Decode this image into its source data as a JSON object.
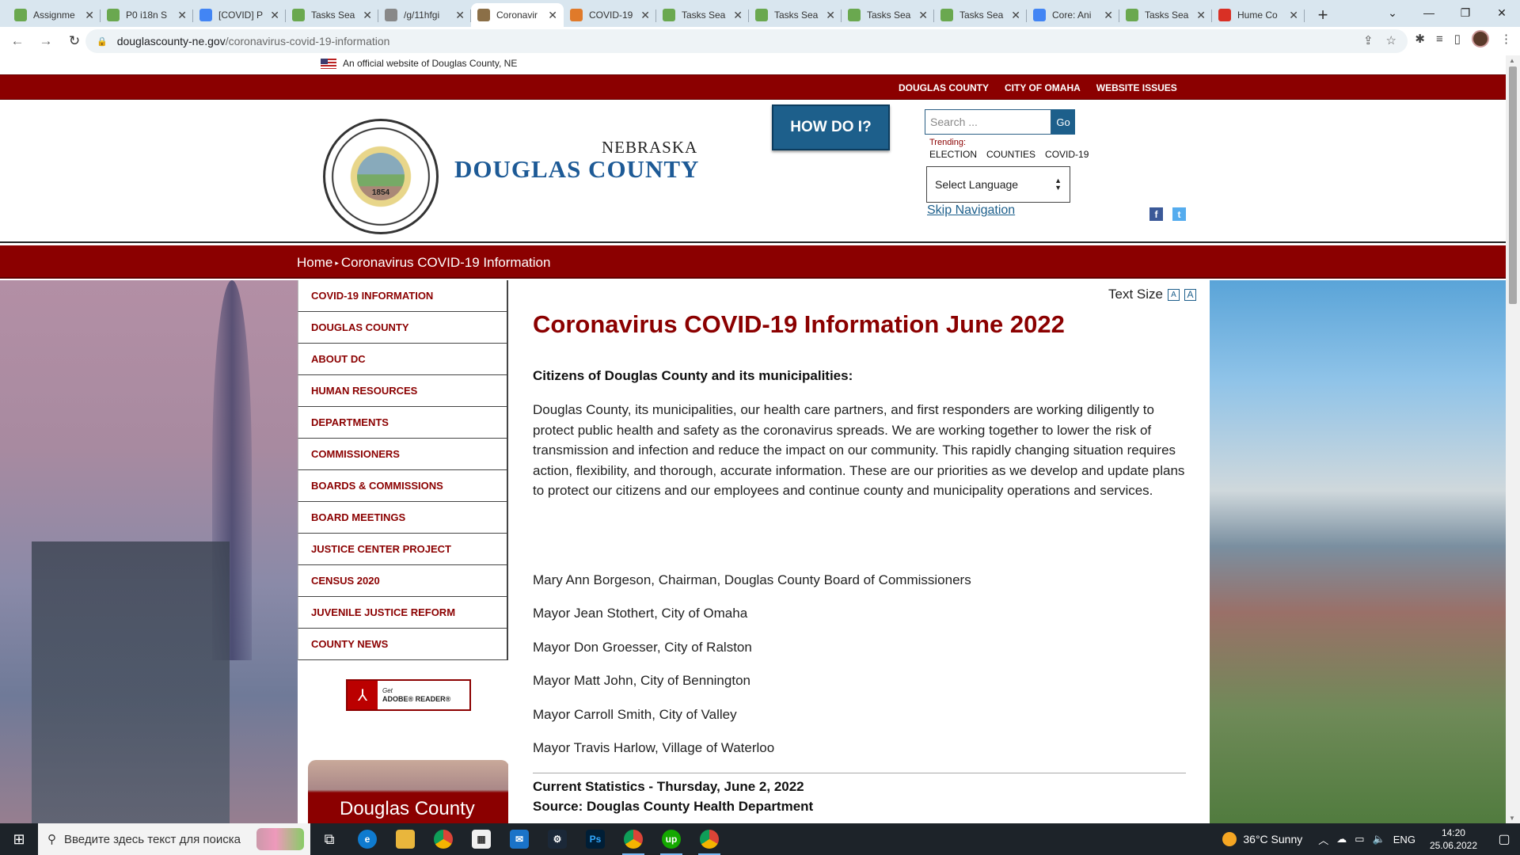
{
  "browser": {
    "tabs": [
      {
        "title": "Assignme",
        "icon": "crowdsource-icon",
        "color": "#6aa84f",
        "active": false
      },
      {
        "title": "P0 i18n S",
        "icon": "crowdsource-icon",
        "color": "#6aa84f",
        "active": false
      },
      {
        "title": "[COVID] P",
        "icon": "google-docs-icon",
        "color": "#4285f4",
        "active": false
      },
      {
        "title": "Tasks Sea",
        "icon": "crowdsource-icon",
        "color": "#6aa84f",
        "active": false
      },
      {
        "title": "/g/11hfgi",
        "icon": "link-icon",
        "color": "#888888",
        "active": false
      },
      {
        "title": "Coronavir",
        "icon": "county-seal-icon",
        "color": "#8b6f47",
        "active": true
      },
      {
        "title": "COVID-19",
        "icon": "covid-icon",
        "color": "#e07a2a",
        "active": false
      },
      {
        "title": "Tasks Sea",
        "icon": "crowdsource-icon",
        "color": "#6aa84f",
        "active": false
      },
      {
        "title": "Tasks Sea",
        "icon": "crowdsource-icon",
        "color": "#6aa84f",
        "active": false
      },
      {
        "title": "Tasks Sea",
        "icon": "crowdsource-icon",
        "color": "#6aa84f",
        "active": false
      },
      {
        "title": "Tasks Sea",
        "icon": "crowdsource-icon",
        "color": "#6aa84f",
        "active": false
      },
      {
        "title": "Core: Ani",
        "icon": "google-docs-icon",
        "color": "#4285f4",
        "active": false
      },
      {
        "title": "Tasks Sea",
        "icon": "crowdsource-icon",
        "color": "#6aa84f",
        "active": false
      },
      {
        "title": "Hume Co",
        "icon": "gmail-icon",
        "color": "#d93025",
        "active": false
      }
    ],
    "url_host": "douglascounty-ne.gov",
    "url_path": "/coronavirus-covid-19-information"
  },
  "site": {
    "official_notice": "An official website of Douglas County, NE",
    "top_links": [
      "DOUGLAS COUNTY",
      "CITY OF OMAHA",
      "WEBSITE ISSUES"
    ],
    "state": "NEBRASKA",
    "county": "DOUGLAS COUNTY",
    "seal_year": "1854",
    "how_do_i": "HOW DO I?",
    "search_placeholder": "Search ...",
    "go": "Go",
    "trending_label": "Trending:",
    "trending": [
      "ELECTION",
      "COUNTIES",
      "COVID-19"
    ],
    "language": "Select Language",
    "skip_nav": "Skip Navigation",
    "breadcrumb": {
      "home": "Home",
      "current": "Coronavirus COVID-19 Information"
    }
  },
  "sidenav": [
    "COVID-19 INFORMATION",
    "DOUGLAS COUNTY",
    "ABOUT DC",
    "HUMAN RESOURCES",
    "DEPARTMENTS",
    "COMMISSIONERS",
    "BOARDS & COMMISSIONS",
    "BOARD MEETINGS",
    "JUSTICE CENTER PROJECT",
    "CENSUS 2020",
    "JUVENILE JUSTICE REFORM",
    "COUNTY NEWS"
  ],
  "adobe": {
    "line1": "Get",
    "line2": "ADOBE® READER®"
  },
  "video_title": "Douglas County",
  "content": {
    "text_size": "Text Size",
    "title": "Coronavirus COVID-19 Information June 2022",
    "intro_heading": "Citizens of Douglas County and its municipalities:",
    "intro_body": "Douglas County, its municipalities, our health care partners, and first responders are working diligently to protect public health and safety as the coronavirus spreads. We are working together to lower the risk of transmission and infection and reduce the impact on our community. This rapidly changing situation requires action, flexibility, and thorough, accurate information. These are our priorities as we develop and update plans to protect our citizens and our employees and continue county and municipality operations and services.",
    "signatories": [
      "Mary Ann Borgeson, Chairman, Douglas County Board of Commissioners",
      "Mayor Jean Stothert, City of Omaha",
      "Mayor Don Groesser, City of Ralston",
      "Mayor Matt John, City of Bennington",
      "Mayor Carroll Smith, City of Valley",
      "Mayor Travis Harlow, Village of Waterloo"
    ],
    "stats_heading": "Current Statistics - Thursday, June 2, 2022",
    "stats_source": "Source: Douglas County Health Department"
  },
  "taskbar": {
    "search_placeholder": "Введите здесь текст для поиска",
    "weather": "36°C  Sunny",
    "lang": "ENG",
    "time": "14:20",
    "date": "25.06.2022"
  },
  "colors": {
    "brand_red": "#8b0000",
    "brand_blue": "#1d5f8b"
  }
}
